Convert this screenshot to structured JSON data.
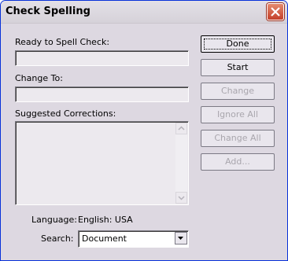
{
  "window": {
    "title": "Check Spelling"
  },
  "labels": {
    "ready": "Ready to Spell Check:",
    "change_to": "Change To:",
    "suggested": "Suggested Corrections:",
    "language": "Language:",
    "language_value": "English: USA",
    "search": "Search:"
  },
  "fields": {
    "ready_value": "",
    "change_to_value": ""
  },
  "suggestions": [],
  "search": {
    "selected": "Document"
  },
  "buttons": {
    "done": "Done",
    "start": "Start",
    "change": "Change",
    "ignore_all": "Ignore All",
    "change_all": "Change All",
    "add": "Add..."
  },
  "icons": {
    "close": "close-icon",
    "scroll_up": "scroll-up-icon",
    "scroll_down": "scroll-down-icon",
    "dropdown": "chevron-down-icon"
  }
}
